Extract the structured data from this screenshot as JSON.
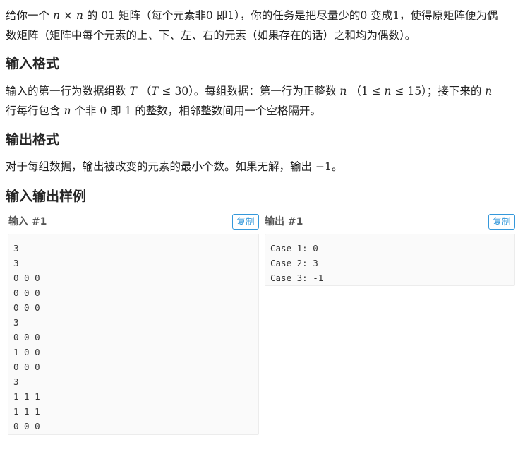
{
  "description": {
    "line1": {
      "p1": "给你一个",
      "n1": "n",
      "times": "×",
      "n2": "n",
      "p2": "的",
      "zero_one": "01",
      "p3": "矩阵（每个元素非",
      "zero": "0",
      "p4": "即",
      "one": "1",
      "p5": "），你的任务是把尽量少的",
      "zero2": "0",
      "p6": "变成",
      "one2": "1",
      "p7": "，使得原矩阵便为偶"
    },
    "line2": "数矩阵（矩阵中每个元素的上、下、左、右的元素（如果存在的话）之和均为偶数）。"
  },
  "input_format": {
    "title": "输入格式",
    "line1": {
      "p1": "输入的第一行为数据组数",
      "T1": "T",
      "open": "（",
      "T2": "T",
      "le": " ≤ ",
      "v30": "30",
      "p2": "）。每组数据：第一行为正整数",
      "n1": "n",
      "open2": "（",
      "v1": "1",
      "le2": " ≤ ",
      "n2": "n",
      "le3": " ≤ ",
      "v15": "15",
      "p3": "）；接下来的",
      "n3": "n"
    },
    "line2": {
      "p1": "行每行包含",
      "n": "n",
      "p2": "个非",
      "zero": "0",
      "p3": "即",
      "one": "1",
      "p4": "的整数，相邻整数间用一个空格隔开。"
    }
  },
  "output_format": {
    "title": "输出格式",
    "line": {
      "p1": "对于每组数据，输出被改变的元素的最小个数。如果无解，输出",
      "neg1": "−1",
      "p2": "。"
    }
  },
  "samples": {
    "title": "输入输出样例",
    "input_label": "输入 #1",
    "output_label": "输出 #1",
    "copy_label": "复制",
    "input_lines": [
      "3",
      "3",
      "0 0 0",
      "0 0 0",
      "0 0 0",
      "3",
      "0 0 0",
      "1 0 0",
      "0 0 0",
      "3",
      "1 1 1",
      "1 1 1",
      "0 0 0"
    ],
    "output_lines": [
      "Case 1: 0",
      "Case 2: 3",
      "Case 3: -1"
    ]
  },
  "colors": {
    "accent": "#3498db",
    "code_bg": "#fafafa"
  }
}
